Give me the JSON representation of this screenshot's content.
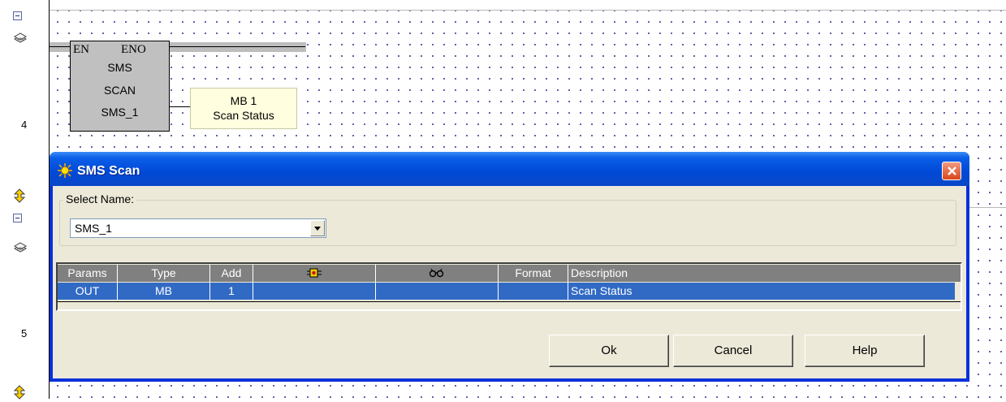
{
  "ladder": {
    "rung_numbers": [
      "4",
      "5"
    ],
    "block": {
      "en_label": "EN",
      "eno_label": "ENO",
      "lines": [
        "SMS",
        "SCAN",
        "SMS_1"
      ]
    },
    "output_operand": {
      "address": "MB 1",
      "symbol": "Scan Status"
    }
  },
  "dialog": {
    "title": "SMS Scan",
    "select_name_label": "Select Name:",
    "select_name_value": "SMS_1",
    "table": {
      "headers": [
        "Params",
        "Type",
        "Add",
        "",
        "",
        "Format",
        "Description"
      ],
      "header_icons": [
        "io-module-icon",
        "binoculars-icon"
      ],
      "rows": [
        [
          "OUT",
          "MB",
          "1",
          "",
          "",
          "",
          "Scan Status"
        ]
      ]
    },
    "buttons": {
      "ok": "Ok",
      "cancel": "Cancel",
      "help": "Help"
    }
  },
  "colors": {
    "title_bar": "#0a5ee8",
    "selected_row": "#316ac5",
    "header_row": "#808080",
    "dialog_face": "#ece9d8",
    "operand_box": "#ffffe0"
  }
}
